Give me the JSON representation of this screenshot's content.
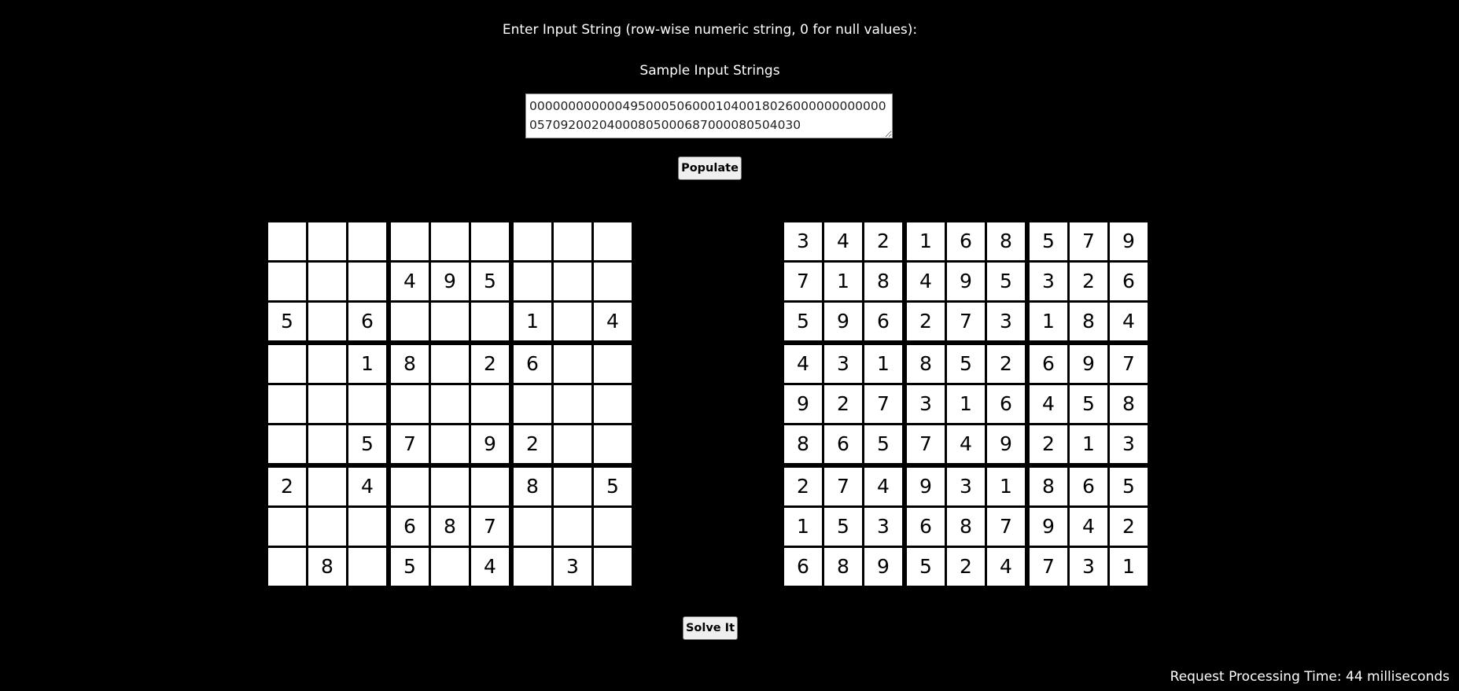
{
  "prompt_label": "Enter Input String (row-wise numeric string, 0 for null values):",
  "samples_label": "Sample Input Strings",
  "input": {
    "value": "000000000000495000506000104001802600000000000005709200204000805000687000080504030"
  },
  "populate_button": "Populate",
  "solve_button": "Solve It",
  "timing": "Request Processing Time: 44 milliseconds",
  "puzzle": [
    [
      "",
      "",
      "",
      "",
      "",
      "",
      "",
      "",
      ""
    ],
    [
      "",
      "",
      "",
      "4",
      "9",
      "5",
      "",
      "",
      ""
    ],
    [
      "5",
      "",
      "6",
      "",
      "",
      "",
      "1",
      "",
      "4"
    ],
    [
      "",
      "",
      "1",
      "8",
      "",
      "2",
      "6",
      "",
      ""
    ],
    [
      "",
      "",
      "",
      "",
      "",
      "",
      "",
      "",
      ""
    ],
    [
      "",
      "",
      "5",
      "7",
      "",
      "9",
      "2",
      "",
      ""
    ],
    [
      "2",
      "",
      "4",
      "",
      "",
      "",
      "8",
      "",
      "5"
    ],
    [
      "",
      "",
      "",
      "6",
      "8",
      "7",
      "",
      "",
      ""
    ],
    [
      "",
      "8",
      "",
      "5",
      "",
      "4",
      "",
      "3",
      ""
    ]
  ],
  "solution": [
    [
      "3",
      "4",
      "2",
      "1",
      "6",
      "8",
      "5",
      "7",
      "9"
    ],
    [
      "7",
      "1",
      "8",
      "4",
      "9",
      "5",
      "3",
      "2",
      "6"
    ],
    [
      "5",
      "9",
      "6",
      "2",
      "7",
      "3",
      "1",
      "8",
      "4"
    ],
    [
      "4",
      "3",
      "1",
      "8",
      "5",
      "2",
      "6",
      "9",
      "7"
    ],
    [
      "9",
      "2",
      "7",
      "3",
      "1",
      "6",
      "4",
      "5",
      "8"
    ],
    [
      "8",
      "6",
      "5",
      "7",
      "4",
      "9",
      "2",
      "1",
      "3"
    ],
    [
      "2",
      "7",
      "4",
      "9",
      "3",
      "1",
      "8",
      "6",
      "5"
    ],
    [
      "1",
      "5",
      "3",
      "6",
      "8",
      "7",
      "9",
      "4",
      "2"
    ],
    [
      "6",
      "8",
      "9",
      "5",
      "2",
      "4",
      "7",
      "3",
      "1"
    ]
  ]
}
